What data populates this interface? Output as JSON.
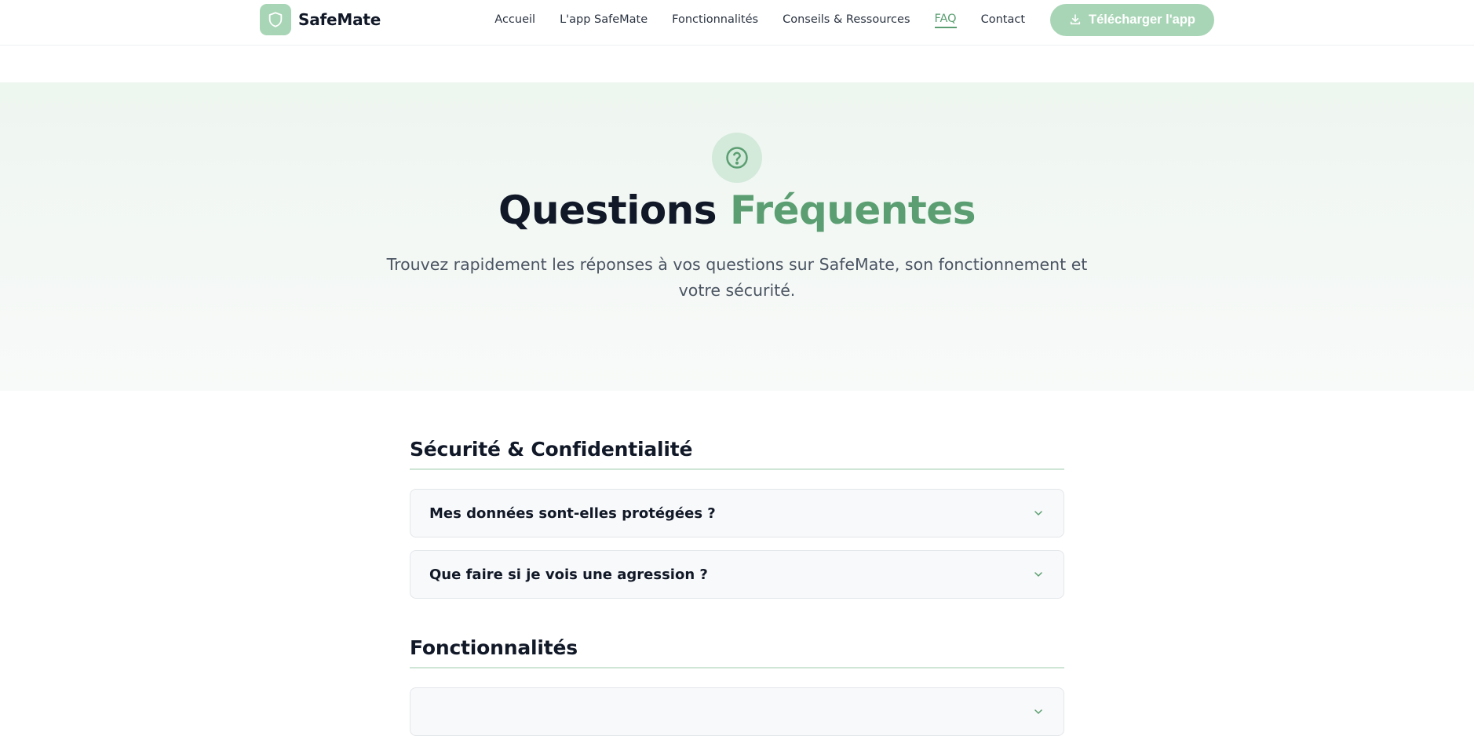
{
  "nav": {
    "brand": "SafeMate",
    "links": [
      {
        "label": "Accueil"
      },
      {
        "label": "L'app SafeMate"
      },
      {
        "label": "Fonctionnalités"
      },
      {
        "label": "Conseils & Ressources"
      },
      {
        "label": "FAQ",
        "active": true
      },
      {
        "label": "Contact"
      }
    ],
    "download_label": "Télécharger l'app"
  },
  "hero": {
    "title_part1": "Questions",
    "title_part2": "Fréquentes",
    "subtitle": "Trouvez rapidement les réponses à vos questions sur SafeMate, son fonctionnement et votre sécurité."
  },
  "faq": {
    "sections": [
      {
        "title": "Sécurité & Confidentialité",
        "questions": [
          "Mes données sont-elles protégées ?",
          "Que faire si je vois une agression ?"
        ]
      },
      {
        "title": "Fonctionnalités"
      }
    ]
  },
  "colors": {
    "accent": "#5a9e71",
    "accent_light": "#a8d5b6",
    "text_dark": "#111827"
  },
  "icons": {
    "logo": "shield-icon",
    "download": "download-icon",
    "hero": "question-circle-icon",
    "expand": "chevron-down-icon"
  }
}
